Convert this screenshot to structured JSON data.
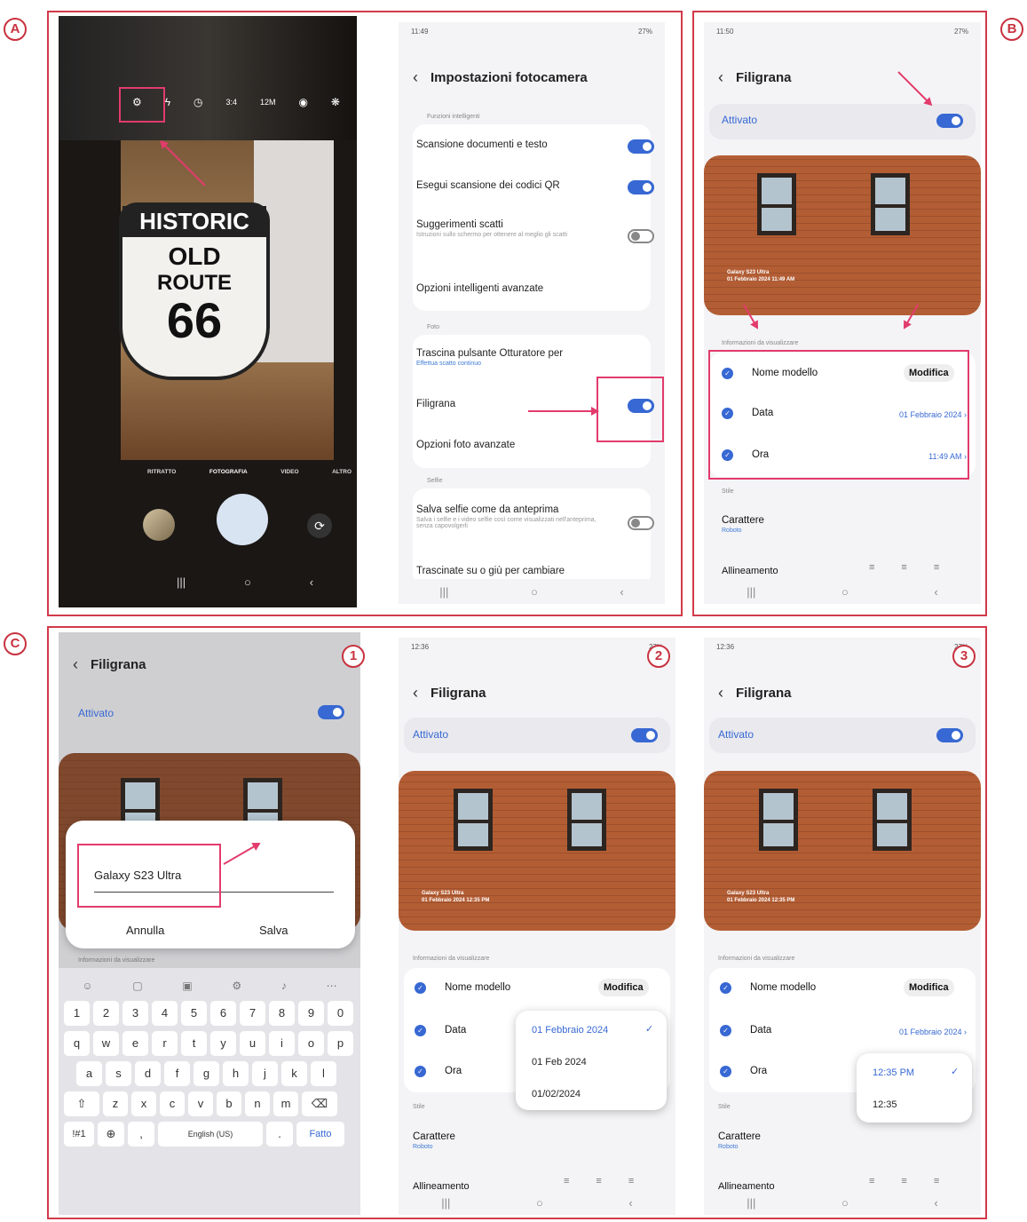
{
  "labels": {
    "a": "A",
    "b": "B",
    "c": "C",
    "n1": "1",
    "n2": "2",
    "n3": "3"
  },
  "camera": {
    "sign_top": "HISTORIC",
    "sign_old": "OLD",
    "sign_route": "ROUTE",
    "sign_num": "66",
    "modes": [
      "RITRATTO",
      "FOTOGRAFIA",
      "VIDEO",
      "ALTRO"
    ],
    "top_icons": [
      "settings-icon",
      "flash-off-icon",
      "timer-icon",
      "ratio-icon",
      "resolution-icon",
      "filter-icon",
      "effects-icon"
    ],
    "res_label": "12M",
    "ratio_label": "3:4"
  },
  "settings": {
    "status_time": "11:49",
    "status_right": "27%",
    "title": "Impostazioni fotocamera",
    "sec_smart": "Funzioni intelligenti",
    "row_scan": "Scansione documenti e testo",
    "row_qr": "Esegui scansione dei codici QR",
    "row_tips": "Suggerimenti scatti",
    "row_tips_sub": "Istruzioni sullo schermo per ottenere al meglio gli scatti",
    "row_adv_smart": "Opzioni intelligenti avanzate",
    "sec_photo": "Foto",
    "row_drag": "Trascina pulsante Otturatore per",
    "row_drag_sub": "Effettua scatto continuo",
    "row_watermark": "Filigrana",
    "row_adv_photo": "Opzioni foto avanzate",
    "sec_selfie": "Selfie",
    "row_selfie": "Salva selfie come da anteprima",
    "row_selfie_sub": "Salva i selfie e i video selfie così come visualizzati nell'anteprima, senza capovolgerli",
    "row_swipe": "Trascinate su o giù per cambiare"
  },
  "watermark": {
    "status_time_b": "11:50",
    "status_time_c": "12:36",
    "status_right": "27%",
    "title": "Filigrana",
    "activated": "Attivato",
    "wm_model": "Galaxy S23 Ultra",
    "wm_date_b": "01 Febbraio 2024 11:49 AM",
    "wm_date_c": "01 Febbraio 2024 12:35 PM",
    "sec_info": "Informazioni da visualizzare",
    "model_label": "Nome modello",
    "edit": "Modifica",
    "date_label": "Data",
    "date_value": "01 Febbraio 2024",
    "time_label": "Ora",
    "time_value": "11:49 AM",
    "sec_style": "Stile",
    "font_label": "Carattere",
    "font_value": "Roboto",
    "align_label": "Allineamento"
  },
  "dialog": {
    "value": "Galaxy S23 Ultra",
    "cancel": "Annulla",
    "save": "Salva",
    "behind": "Informazioni da visualizzare"
  },
  "keyboard": {
    "row_nums": [
      "1",
      "2",
      "3",
      "4",
      "5",
      "6",
      "7",
      "8",
      "9",
      "0"
    ],
    "row1": [
      "q",
      "w",
      "e",
      "r",
      "t",
      "y",
      "u",
      "i",
      "o",
      "p"
    ],
    "row2": [
      "a",
      "s",
      "d",
      "f",
      "g",
      "h",
      "j",
      "k",
      "l"
    ],
    "row3": [
      "z",
      "x",
      "c",
      "v",
      "b",
      "n",
      "m"
    ],
    "sym": "!#1",
    "comma": ",",
    "space": "English (US)",
    "dot": ".",
    "done": "Fatto"
  },
  "date_popup": [
    "01 Febbraio 2024",
    "01 Feb 2024",
    "01/02/2024"
  ],
  "time_popup": [
    "12:35 PM",
    "12:35"
  ]
}
